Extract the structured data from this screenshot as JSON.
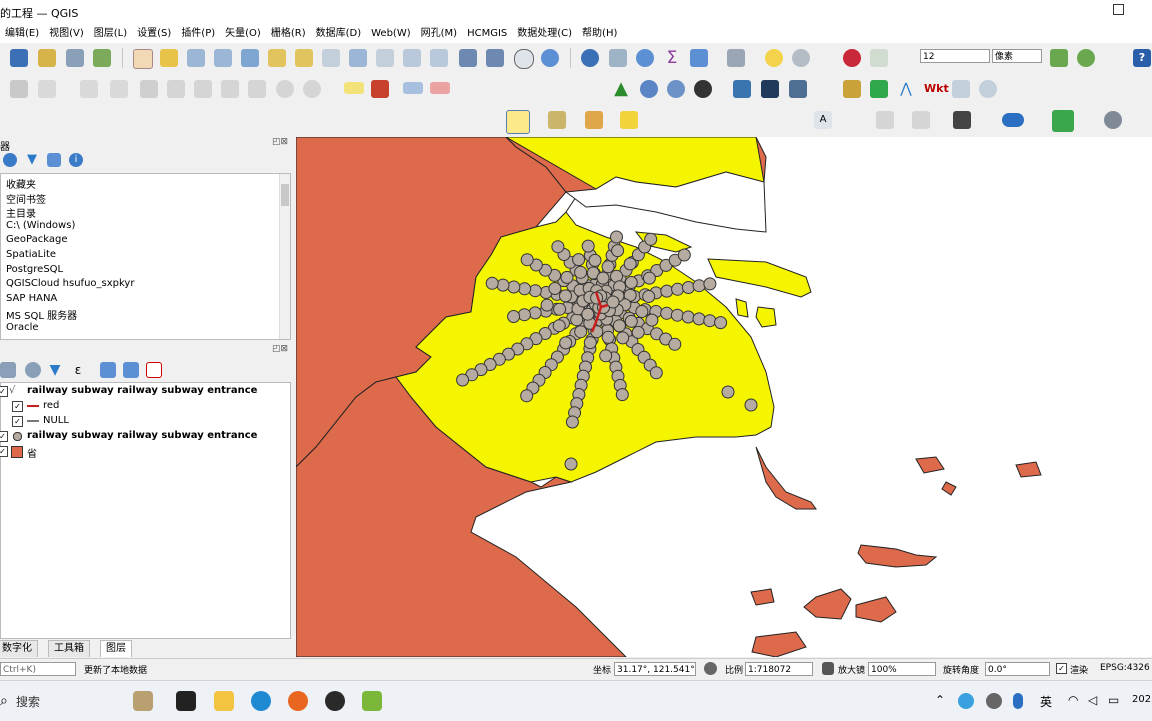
{
  "window": {
    "title": "的工程 — QGIS"
  },
  "menubar": {
    "items": [
      "编辑(E)",
      "视图(V)",
      "图层(L)",
      "设置(S)",
      "插件(P)",
      "矢量(O)",
      "栅格(R)",
      "数据库(D)",
      "Web(W)",
      "网孔(M)",
      "HCMGIS",
      "数据处理(C)",
      "帮助(H)"
    ]
  },
  "toolbar": {
    "scale_field": "12",
    "font_combo": "像素"
  },
  "browser_panel": {
    "title": "器",
    "items": [
      "收藏夹",
      "空间书签",
      "主目录",
      "C:\\ (Windows)",
      "GeoPackage",
      "SpatiaLite",
      "PostgreSQL",
      "QGISCloud hsufuo_sxpkyr",
      "SAP HANA",
      "MS SQL 服务器",
      "Oracle"
    ]
  },
  "layers_panel": {
    "layers": [
      {
        "name": "railway subway railway subway entrance",
        "bold": true
      },
      {
        "name": "red",
        "bold": false
      },
      {
        "name": "NULL",
        "bold": false
      },
      {
        "name": "railway subway railway subway entrance",
        "bold": true
      },
      {
        "name": "省",
        "bold": false
      }
    ]
  },
  "tabs": {
    "items": [
      "数字化",
      "工具箱",
      "图层"
    ],
    "active": "图层"
  },
  "statusbar": {
    "search_placeholder": "Ctrl+K)",
    "message": "更新了本地数据",
    "coord_label": "坐标",
    "coord_value": "31.17°, 121.541°",
    "scale_label": "比例",
    "scale_value": "1:718072",
    "magnifier_label": "放大镜",
    "magnifier_value": "100%",
    "rotation_label": "旋转角度",
    "rotation_value": "0.0°",
    "render_label": "渲染",
    "crs": "EPSG:4326"
  },
  "taskbar": {
    "search_placeholder": "搜索",
    "ime": "英",
    "clock": "202"
  },
  "colors": {
    "province": "#de6a4c",
    "shanghai": "#f5f500",
    "station": "#b5aba0",
    "railway": "#c81e1e"
  }
}
